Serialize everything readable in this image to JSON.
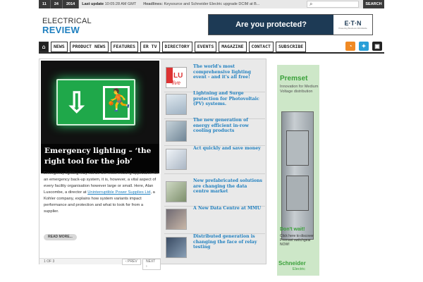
{
  "topbar": {
    "day": "11",
    "month": "24",
    "year": "2014",
    "last_update_label": "Last update",
    "last_update_value": "10:05:28 AM GMT",
    "headlines_label": "Headlines:",
    "headline": "Keysource and Schneider Electric upgrade DCIM at B...",
    "search_button": "SEARCH"
  },
  "logo": {
    "line1": "ELECTRICAL",
    "line2": "REVIEW"
  },
  "banner": {
    "text": "Are you protected?",
    "brand": "E·T·N",
    "tagline": "Powering Business Worldwide"
  },
  "nav": {
    "home": "⌂",
    "items": [
      "NEWS",
      "PRODUCT NEWS",
      "FEATURES",
      "ER TV",
      "DIRECTORY",
      "EVENTS",
      "MAGAZINE",
      "CONTACT",
      "SUBSCRIBE"
    ],
    "rss": "◔",
    "twitter": "✦",
    "other": "▣"
  },
  "feature": {
    "title": "Emergency lighting – ‘the right tool for the job’",
    "text_before": "Emergency lighting may not be the most exciting application for an emergency back-up system, it is, however, a vital aspect of every facility organisation however large or small. Here, Alan Luscombe, a director at ",
    "link": "Uninterruptible Power Supplies Ltd",
    "text_after": ", a Kohler company, explains how system variants impact performance and protection and what to look for from a supplier.",
    "read_more": "READ MORE...",
    "counter": "1 OF 3",
    "prev": "‹ PREV",
    "next": "NEXT ›"
  },
  "list": [
    {
      "title": "The world's most comprehensive lighting event - and it's all free!"
    },
    {
      "title": "Lightning and Surge protection for Photovoltaic (PV) systems."
    },
    {
      "title": "The new generation of energy efficient in-row cooling products"
    },
    {
      "title": "Act quickly and save money"
    },
    {
      "title": "New prefabricated solutions are changing the data centre market"
    },
    {
      "title": "A New Data Centre at MMU"
    },
    {
      "title": "Distributed generation is changing the face of relay testing"
    }
  ],
  "ad": {
    "brand": "Premset",
    "subtitle": "Innovation for Medium Voltage distribution",
    "wait": "Don't wait!",
    "click": "Click here to discover Premset switchgear NOW!",
    "schneider": "Schneider",
    "electric": "Electric"
  },
  "colors": {
    "accent": "#1e7fbf",
    "nav_bar": "#2a2a2a",
    "ad_green": "#3aa03a",
    "sign_green": "#1fa84a"
  }
}
